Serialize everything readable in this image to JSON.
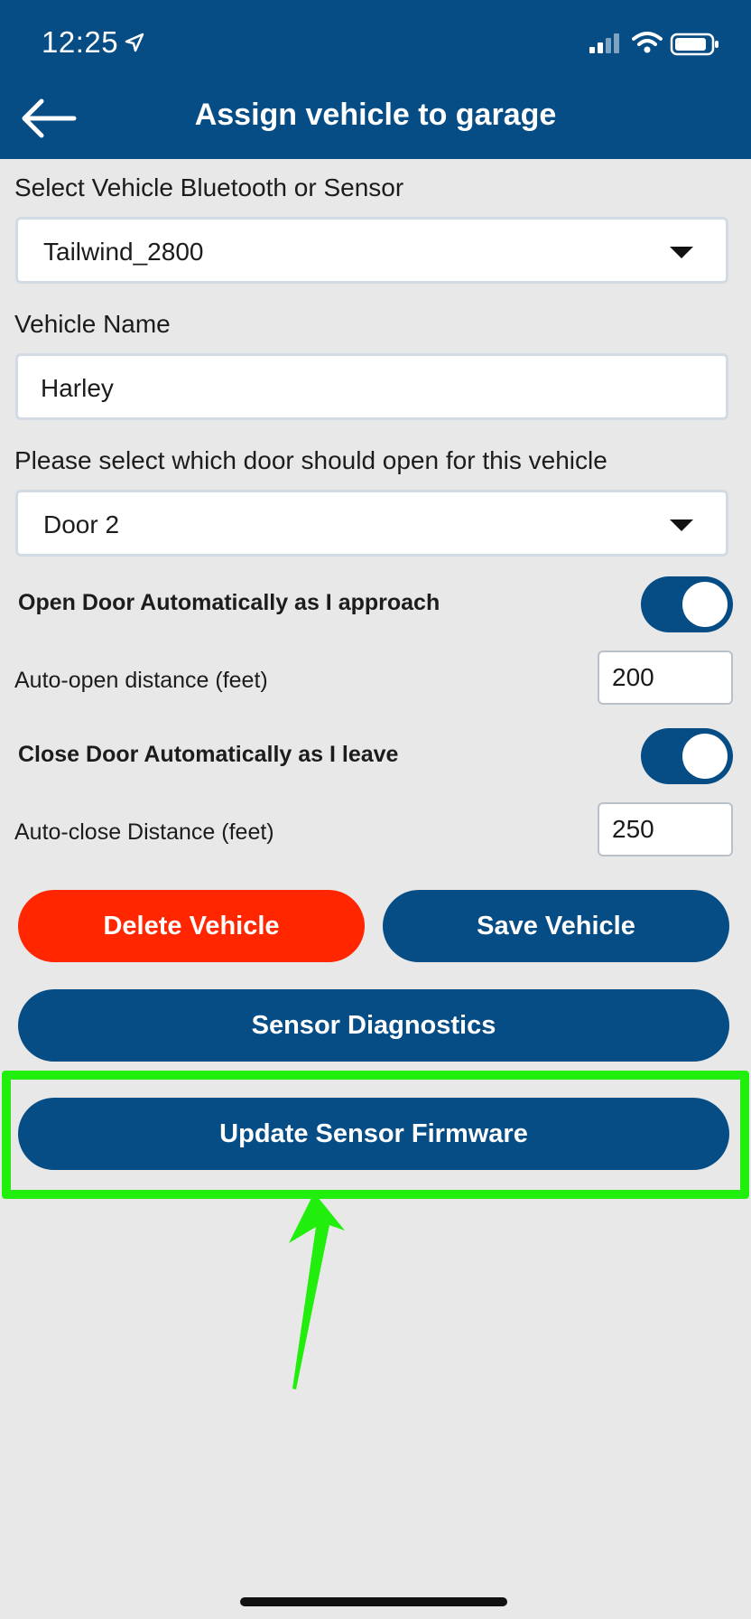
{
  "status_bar": {
    "time": "12:25"
  },
  "header": {
    "title": "Assign vehicle to garage"
  },
  "form": {
    "vehicle_sensor_label": "Select Vehicle Bluetooth or Sensor",
    "vehicle_sensor_value": "Tailwind_2800",
    "vehicle_name_label": "Vehicle Name",
    "vehicle_name_value": "Harley",
    "door_label": "Please select which door should open for this vehicle",
    "door_value": "Door 2",
    "auto_open_label": "Open Door Automatically as I approach",
    "auto_open_enabled": true,
    "auto_open_distance_label": "Auto-open distance (feet)",
    "auto_open_distance_value": "200",
    "auto_close_label": "Close Door Automatically as I leave",
    "auto_close_enabled": true,
    "auto_close_distance_label": "Auto-close Distance (feet)",
    "auto_close_distance_value": "250"
  },
  "buttons": {
    "delete": "Delete Vehicle",
    "save": "Save Vehicle",
    "diagnostics": "Sensor Diagnostics",
    "update_firmware": "Update Sensor Firmware"
  },
  "colors": {
    "brand": "#074d85",
    "danger": "#ff2600",
    "highlight": "#22ee0d",
    "background": "#e8e8e8"
  },
  "icons": {
    "back": "arrow-left-icon",
    "location": "location-arrow-icon",
    "signal": "cellular-signal-icon",
    "wifi": "wifi-icon",
    "battery": "battery-icon",
    "dropdown": "chevron-down-icon",
    "callout": "green-arrow-icon"
  }
}
